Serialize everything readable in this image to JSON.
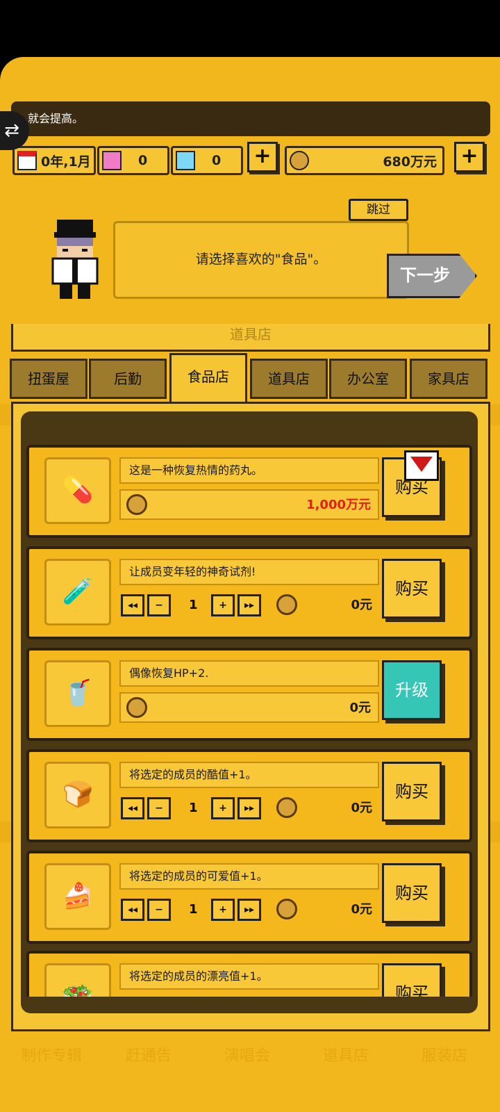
{
  "tip_text": "就会提高。",
  "status": {
    "date": "0年,1月",
    "gem_pink": "0",
    "gem_blue": "0",
    "money": "680万元",
    "icons": [
      "calendar-icon",
      "pink-gem-icon",
      "blue-gem-icon",
      "coin-icon"
    ]
  },
  "tutorial": {
    "skip": "跳过",
    "message": "请选择喜欢的\"食品\"。",
    "next": "下一步"
  },
  "panel_title": "道具店",
  "tabs": [
    "扭蛋屋",
    "后勤",
    "食品店",
    "道具店",
    "办公室",
    "家具店"
  ],
  "active_tab": 2,
  "items": [
    {
      "desc": "这是一种恢复热情的药丸。",
      "price": "1,000万元",
      "button": "购买",
      "has_qty": false,
      "icon": "pill-icon"
    },
    {
      "desc": "让成员变年轻的神奇试剂!",
      "price": "0元",
      "qty": "1",
      "button": "购买",
      "has_qty": true,
      "icon": "potion-icon"
    },
    {
      "desc": "偶像恢复HP+2.",
      "price": "0元",
      "button": "升级",
      "has_qty": false,
      "icon": "drink-icon"
    },
    {
      "desc": "将选定的成员的酷值+1。",
      "price": "0元",
      "qty": "1",
      "button": "购买",
      "has_qty": true,
      "icon": "bread-icon"
    },
    {
      "desc": "将选定的成员的可爱值+1。",
      "price": "0元",
      "qty": "1",
      "button": "购买",
      "has_qty": true,
      "icon": "cake-icon"
    },
    {
      "desc": "将选定的成员的漂亮值+1。",
      "price": "",
      "qty": "",
      "button": "购买",
      "has_qty": true,
      "icon": "food-icon"
    }
  ],
  "qty_buttons": {
    "first": "◂◂",
    "minus": "−",
    "plus": "+",
    "last": "▸▸"
  },
  "bottom_nav": [
    "制作专辑",
    "赶通告",
    "演唱会",
    "道具店",
    "服装店"
  ]
}
